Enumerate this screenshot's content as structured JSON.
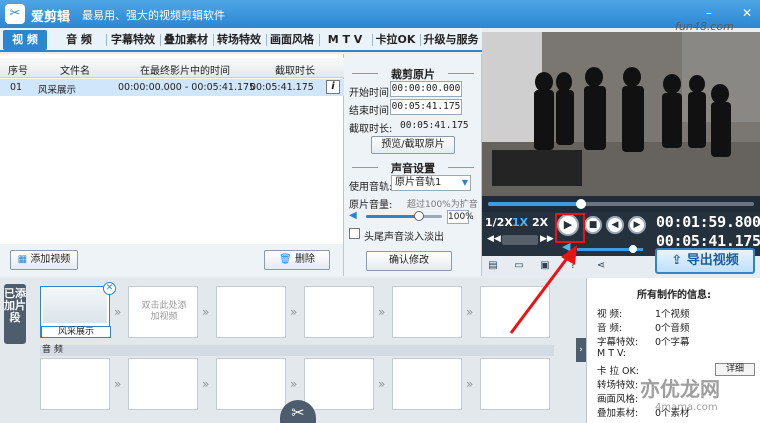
{
  "titlebar": {
    "app_name": "爱剪辑",
    "slogan": "最易用、强大的视频剪辑软件",
    "watermark_site": "fun48.com"
  },
  "tabs": [
    {
      "label": "视 频",
      "active": true
    },
    {
      "label": "音 频",
      "active": false
    },
    {
      "label": "字幕特效",
      "active": false
    },
    {
      "label": "叠加素材",
      "active": false
    },
    {
      "label": "转场特效",
      "active": false
    },
    {
      "label": "画面风格",
      "active": false
    },
    {
      "label": "M T V",
      "active": false
    },
    {
      "label": "卡拉OK",
      "active": false
    },
    {
      "label": "升级与服务",
      "active": false
    }
  ],
  "media_table": {
    "headers": [
      "序号",
      "文件名",
      "在最终影片中的时间",
      "截取时长"
    ],
    "rows": [
      {
        "index": "01",
        "filename": "风采展示",
        "time_range": "00:00:00.000 - 00:05:41.175",
        "duration": "00:05:41.175"
      }
    ]
  },
  "trim_panel": {
    "title": "裁剪原片",
    "start_label": "开始时间:",
    "start_value": "00:00:00.000",
    "end_label": "结束时间:",
    "end_value": "00:05:41.175",
    "dur_label": "截取时长:",
    "dur_value": "00:05:41.175",
    "preview_button": "预览/截取原片"
  },
  "sound_panel": {
    "title": "声音设置",
    "track_label": "使用音轨:",
    "track_value": "原片音轨1",
    "volume_label": "原片音量:",
    "volume_hint": "超过100%为扩音",
    "volume_pct": "100%",
    "volume_level": 0.7,
    "fade_label": "头尾声音淡入淡出",
    "confirm_button": "确认修改"
  },
  "actions": {
    "add_video": "添加视频",
    "delete": "删除"
  },
  "player": {
    "progress": 0.35,
    "speeds": [
      "1/2X",
      "1X",
      "2X"
    ],
    "active_speed": "1X",
    "current_time": "00:01:59.800",
    "total_time": "00:05:41.175",
    "volume_level": 0.85,
    "export_button": "导出视频"
  },
  "timeline": {
    "side_label": "已添加片段",
    "first_clip": "风采展示",
    "placeholder": "双击此处添加视频",
    "audio_title": "音 频"
  },
  "info_panel": {
    "title": "所有制作的信息:",
    "lines": [
      {
        "label": "视    频:",
        "value": "1个视频"
      },
      {
        "label": "音    频:",
        "value": "0个音频"
      },
      {
        "label": "字幕特效:",
        "value": "0个字幕"
      },
      {
        "label": "M  T  V:",
        "value": ""
      },
      {
        "label": "卡  拉  OK:",
        "value": ""
      },
      {
        "label": "转场特效:",
        "value": ""
      },
      {
        "label": "画面风格:",
        "value": ""
      },
      {
        "label": "叠加素材:",
        "value": "0个素材"
      }
    ],
    "detail_button": "详细"
  },
  "watermark": {
    "text": "亦优龙网",
    "sub": "4mama.com"
  }
}
